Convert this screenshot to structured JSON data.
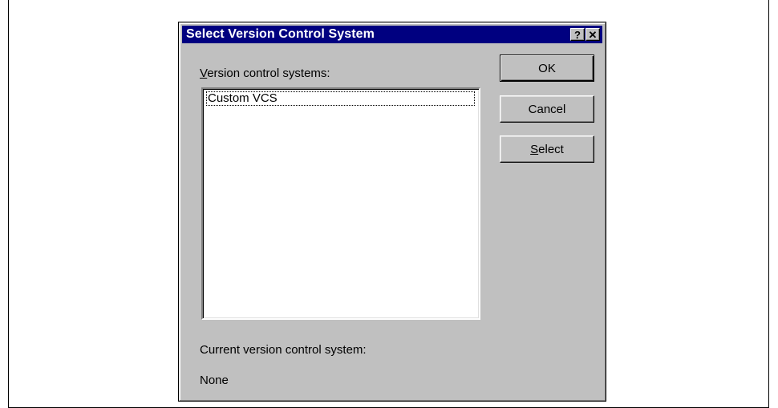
{
  "dialog": {
    "title": "Select Version Control System",
    "help_glyph": "?",
    "close_glyph": "✕"
  },
  "list": {
    "label_prefix": "",
    "label_accel": "V",
    "label_rest": "ersion control systems:",
    "items": [
      "Custom VCS"
    ]
  },
  "buttons": {
    "ok": "OK",
    "cancel": "Cancel",
    "select_accel": "S",
    "select_rest": "elect"
  },
  "current": {
    "label": "Current version control system:",
    "value": "None"
  }
}
